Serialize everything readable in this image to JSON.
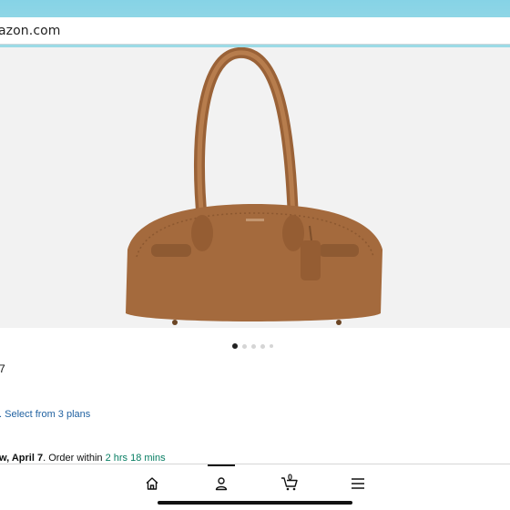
{
  "browser": {
    "url_text": "azon.com"
  },
  "product_image": {
    "icon": "handbag-image",
    "carousel_dots": 5,
    "active_dot": 0
  },
  "details": {
    "price_fragment": "7",
    "plans_link": ". Select from 3 plans",
    "delivery_prefix": "w, April 7",
    "delivery_middle": ". Order within ",
    "delivery_countdown": "2 hrs 18 mins"
  },
  "bottom_nav": {
    "items": [
      {
        "name": "home",
        "icon": "home-icon"
      },
      {
        "name": "account",
        "icon": "person-icon"
      },
      {
        "name": "cart",
        "icon": "cart-icon"
      },
      {
        "name": "menu",
        "icon": "menu-icon"
      }
    ],
    "cart_count": "0",
    "active_index": 1
  },
  "colors": {
    "link": "#2162a1",
    "countdown": "#067d62",
    "bag": "#a46a3d"
  }
}
